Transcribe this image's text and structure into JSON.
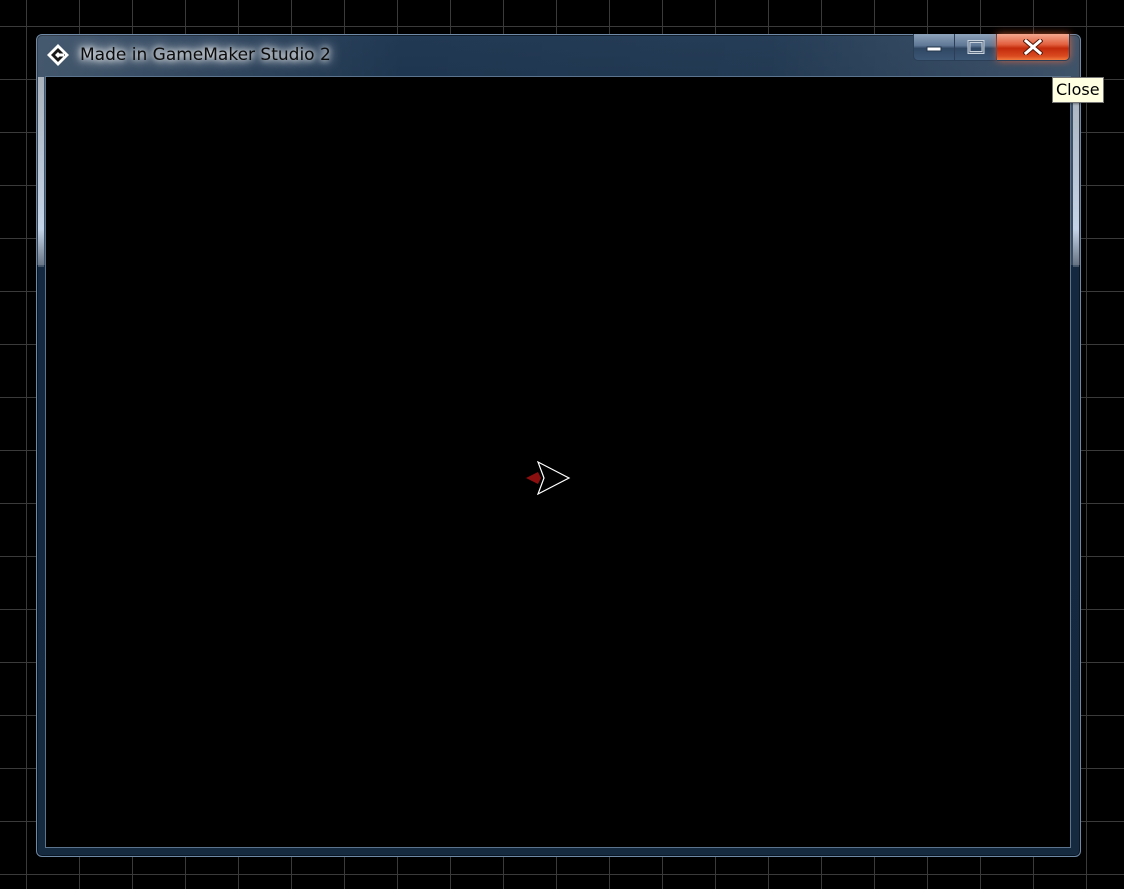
{
  "window": {
    "title": "Made in GameMaker Studio 2",
    "icon": "gamemaker-icon"
  },
  "caption_buttons": {
    "minimize_icon": "minimize-icon",
    "maximize_icon": "maximize-icon",
    "close_icon": "close-icon"
  },
  "tooltip": {
    "text": "Close"
  },
  "game": {
    "sprite": "arrow-ship-icon",
    "colors": {
      "background": "#000000",
      "grid": "#3a3a3a",
      "ship_outline": "#ffffff",
      "ship_thruster": "#8b0f0f"
    }
  }
}
